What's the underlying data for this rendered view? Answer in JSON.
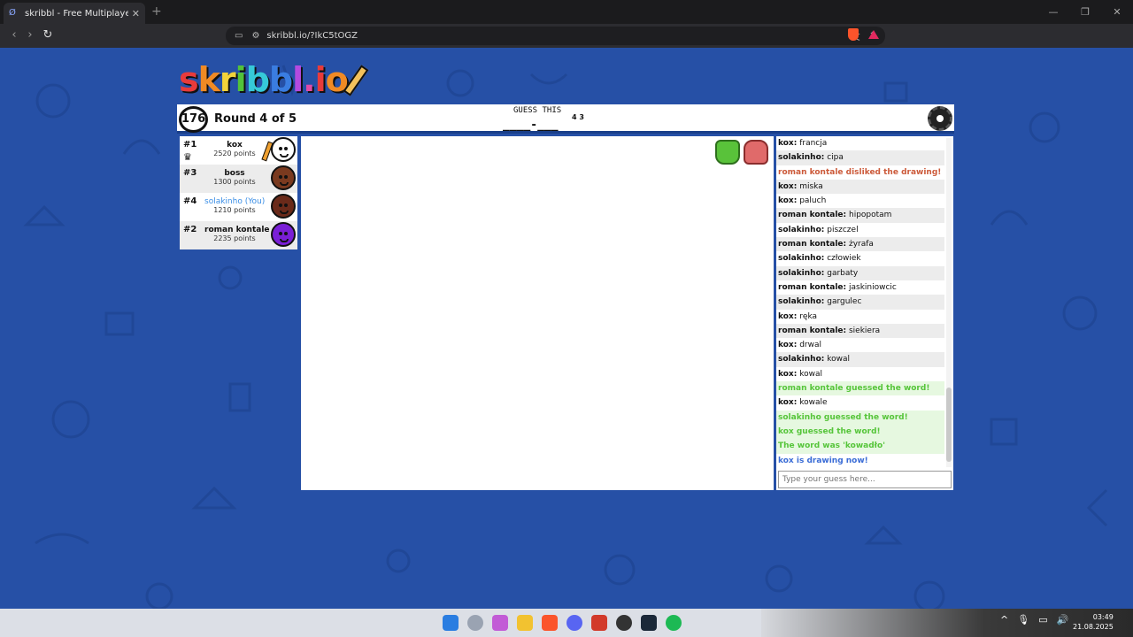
{
  "browser": {
    "tab_title": "skribbl - Free Multiplayer Drawin",
    "tab_close": "✕",
    "new_tab": "+",
    "url": "skribbl.io/?IkC5tOGZ"
  },
  "game": {
    "logo_text": "skribbl.io",
    "timer": "176",
    "round": "Round 4 of 5",
    "guess_label": "GUESS THIS",
    "word_blanks": "____-___",
    "word_lengths": "4 3"
  },
  "players": [
    {
      "rank": "#1",
      "name": "kox",
      "points": "2520 points",
      "you": false,
      "avatar_color": "#ffffff",
      "drawing": true,
      "crown": true
    },
    {
      "rank": "#3",
      "name": "boss",
      "points": "1300 points",
      "you": false,
      "avatar_color": "#7a3a1f",
      "drawing": false,
      "crown": false
    },
    {
      "rank": "#4",
      "name": "solakinho (You)",
      "points": "1210 points",
      "you": true,
      "avatar_color": "#6a2a1a",
      "drawing": false,
      "crown": false
    },
    {
      "rank": "#2",
      "name": "roman kontale",
      "points": "2235 points",
      "you": false,
      "avatar_color": "#7a1fd6",
      "drawing": false,
      "crown": false
    }
  ],
  "chat": {
    "messages": [
      {
        "user": "kox:",
        "text": " francja",
        "type": "normal"
      },
      {
        "user": "solakinho:",
        "text": " cipa",
        "type": "normal"
      },
      {
        "user": "",
        "text": "roman kontale disliked the drawing!",
        "type": "red"
      },
      {
        "user": "kox:",
        "text": " miska",
        "type": "normal"
      },
      {
        "user": "kox:",
        "text": " paluch",
        "type": "normal"
      },
      {
        "user": "roman kontale:",
        "text": " hipopotam",
        "type": "normal"
      },
      {
        "user": "solakinho:",
        "text": " piszczel",
        "type": "normal"
      },
      {
        "user": "roman kontale:",
        "text": " żyrafa",
        "type": "normal"
      },
      {
        "user": "solakinho:",
        "text": " człowiek",
        "type": "normal"
      },
      {
        "user": "solakinho:",
        "text": " garbaty",
        "type": "normal"
      },
      {
        "user": "roman kontale:",
        "text": " jaskiniowcic",
        "type": "normal"
      },
      {
        "user": "solakinho:",
        "text": " gargulec",
        "type": "normal"
      },
      {
        "user": "kox:",
        "text": " ręka",
        "type": "normal"
      },
      {
        "user": "roman kontale:",
        "text": " siekiera",
        "type": "normal"
      },
      {
        "user": "kox:",
        "text": " drwal",
        "type": "normal"
      },
      {
        "user": "solakinho:",
        "text": " kowal",
        "type": "normal"
      },
      {
        "user": "kox:",
        "text": " kowal",
        "type": "normal"
      },
      {
        "user": "",
        "text": "roman kontale guessed the word!",
        "type": "green"
      },
      {
        "user": "kox:",
        "text": " kowale",
        "type": "normal"
      },
      {
        "user": "",
        "text": "solakinho guessed the word!",
        "type": "green"
      },
      {
        "user": "",
        "text": "kox guessed the word!",
        "type": "green"
      },
      {
        "user": "",
        "text": "The word was 'kowadło'",
        "type": "green"
      },
      {
        "user": "",
        "text": "kox is drawing now!",
        "type": "blue"
      }
    ],
    "input_placeholder": "Type your guess here..."
  },
  "taskbar": {
    "time": "03:49",
    "date": "21.08.2025"
  },
  "colors": {
    "page_bg": "#2650a6",
    "accent_blue": "#1a3f8a"
  }
}
